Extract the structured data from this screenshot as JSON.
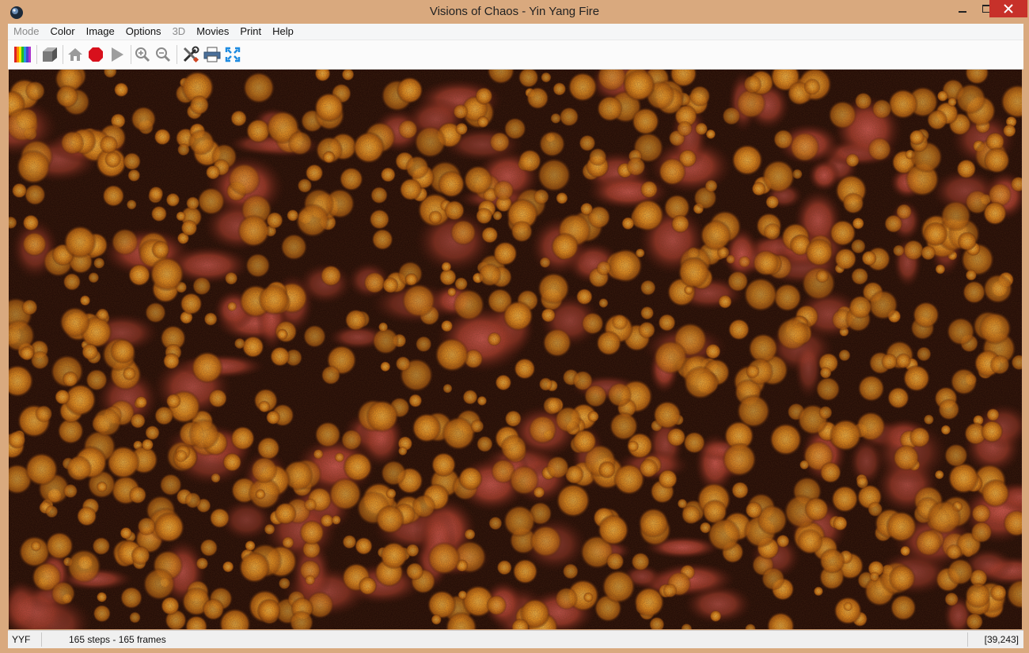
{
  "window": {
    "title": "Visions of Chaos - Yin Yang Fire"
  },
  "menu": [
    {
      "label": "Mode",
      "disabled": true
    },
    {
      "label": "Color",
      "disabled": false
    },
    {
      "label": "Image",
      "disabled": false
    },
    {
      "label": "Options",
      "disabled": false
    },
    {
      "label": "3D",
      "disabled": true
    },
    {
      "label": "Movies",
      "disabled": false
    },
    {
      "label": "Print",
      "disabled": false
    },
    {
      "label": "Help",
      "disabled": false
    }
  ],
  "toolbar": {
    "icons": [
      "palette-icon",
      "cube-icon",
      "home-icon",
      "stop-icon",
      "play-icon",
      "zoom-in-icon",
      "zoom-out-icon",
      "tools-icon",
      "printer-icon",
      "fullscreen-icon"
    ]
  },
  "status": {
    "mode": "YYF",
    "steps": "165 steps - 165 frames",
    "coords": "[39,243]"
  },
  "colors": {
    "fire_dark": "#1a0703",
    "fire_red": "#b3402e",
    "fire_orange": "#e88a1c",
    "fire_bright": "#ffb43c",
    "close_button": "#c7312a",
    "frame": "#d9a97e"
  }
}
